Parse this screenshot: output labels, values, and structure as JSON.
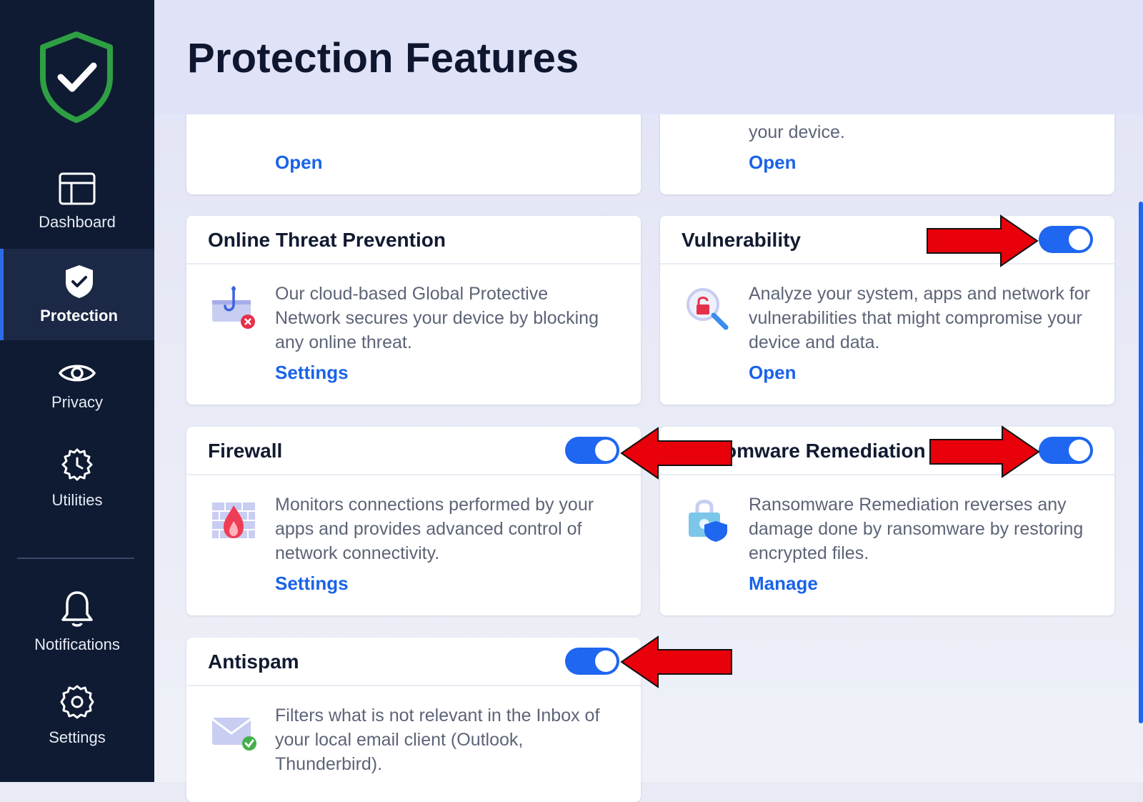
{
  "sidebar": {
    "items": [
      {
        "label": "Dashboard",
        "icon": "dashboard-icon"
      },
      {
        "label": "Protection",
        "icon": "shield-check-icon",
        "active": true
      },
      {
        "label": "Privacy",
        "icon": "eye-icon"
      },
      {
        "label": "Utilities",
        "icon": "gear-clock-icon"
      },
      {
        "label": "Notifications",
        "icon": "bell-icon"
      },
      {
        "label": "Settings",
        "icon": "gear-icon"
      }
    ]
  },
  "header": {
    "title": "Protection Features"
  },
  "cards": {
    "top_left": {
      "link": "Open"
    },
    "top_right": {
      "desc": "your device.",
      "link": "Open"
    },
    "online_threat": {
      "title": "Online Threat Prevention",
      "desc": "Our cloud-based Global Protective Network secures your device by blocking any online threat.",
      "link": "Settings",
      "icon": "phishing-hook-icon"
    },
    "vulnerability": {
      "title": "Vulnerability",
      "desc": "Analyze your system, apps and network for vulnerabilities that might compromise your device and data.",
      "link": "Open",
      "toggle_on": true,
      "icon": "magnifier-lock-icon"
    },
    "firewall": {
      "title": "Firewall",
      "desc": "Monitors connections performed by your apps and provides advanced control of network connectivity.",
      "link": "Settings",
      "toggle_on": true,
      "icon": "firewall-icon"
    },
    "ransomware": {
      "title": "omware Remediation",
      "desc": "Ransomware Remediation reverses any damage done by ransomware by restoring encrypted files.",
      "link": "Manage",
      "toggle_on": true,
      "icon": "lock-shield-icon"
    },
    "antispam": {
      "title": "Antispam",
      "desc": "Filters what is not relevant in the Inbox of your local email client (Outlook, Thunderbird).",
      "toggle_on": true,
      "icon": "mail-check-icon"
    }
  },
  "colors": {
    "sidebar_bg": "#0f1b33",
    "accent": "#1f66f0",
    "link": "#1a63e8",
    "annotation_arrow": "#e8000b",
    "logo_green": "#2ea043"
  }
}
